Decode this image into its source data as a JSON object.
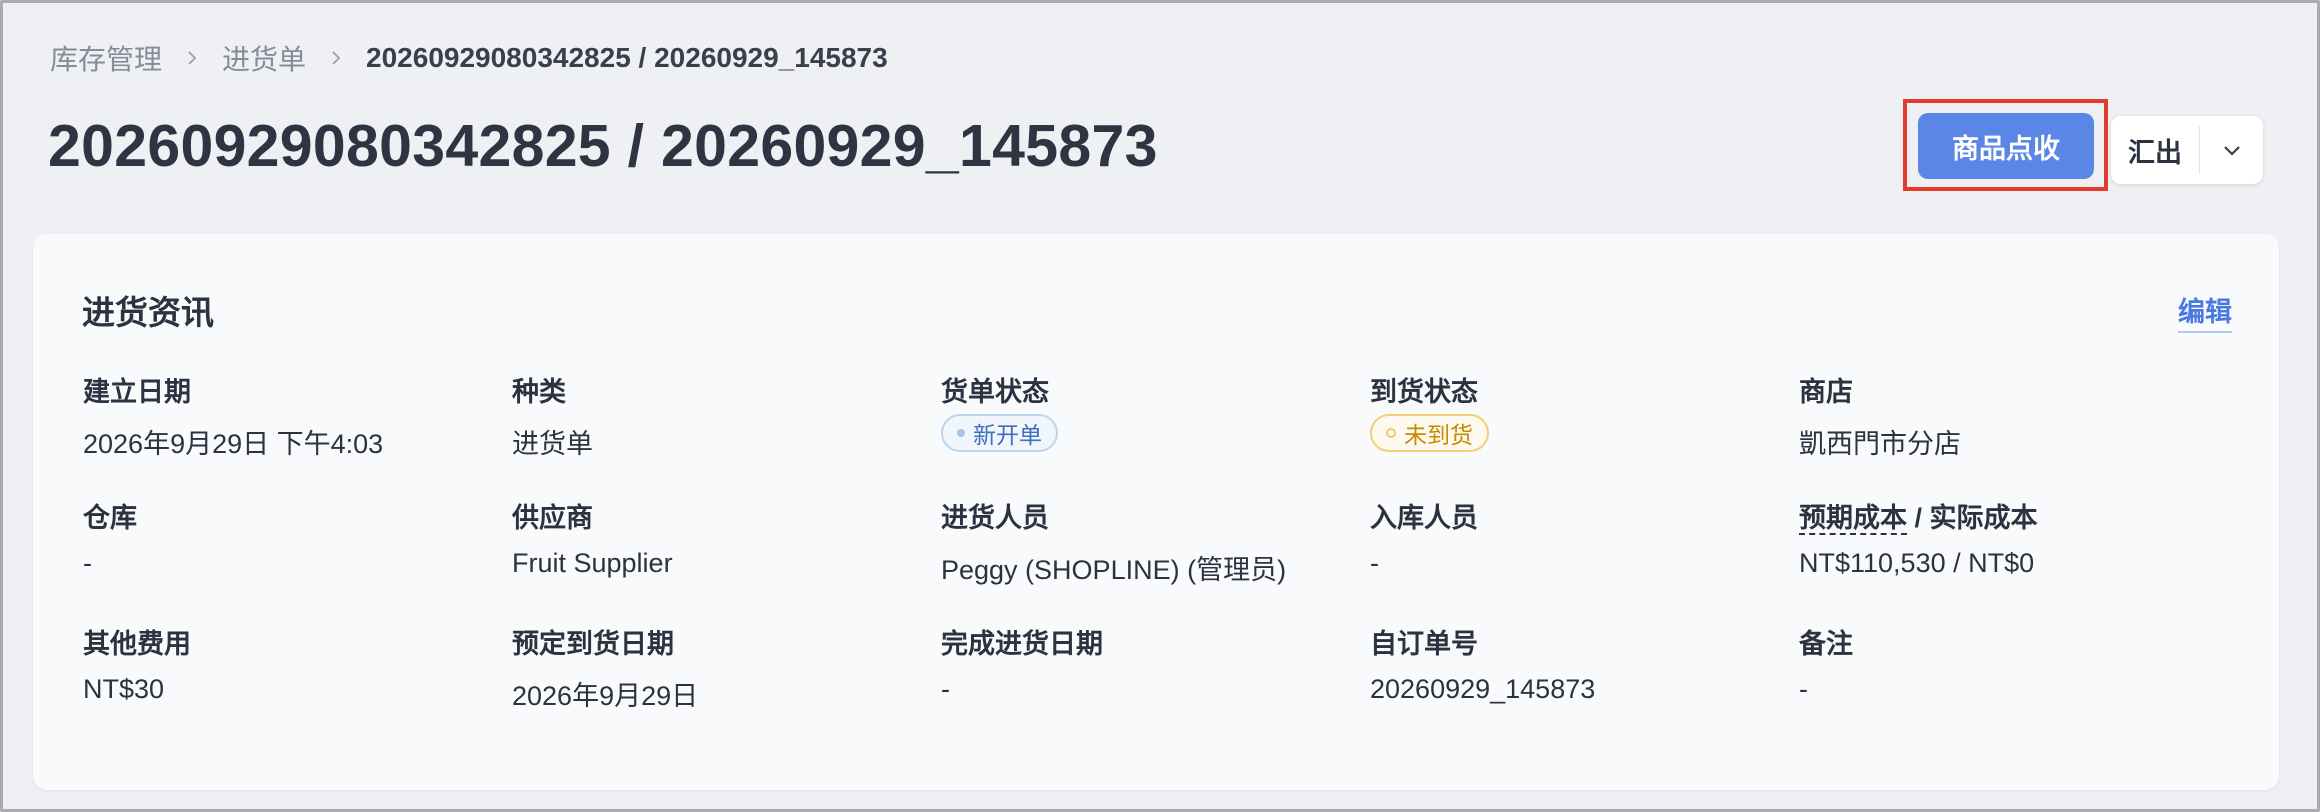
{
  "breadcrumb": {
    "items": [
      "库存管理",
      "进货单"
    ],
    "current": "20260929080342825 / 20260929_145873"
  },
  "page_title": "20260929080342825 / 20260929_145873",
  "actions": {
    "receive_label": "商品点收",
    "export_label": "汇出"
  },
  "colors": {
    "primary": "#5a87e6",
    "highlight": "#e03b2c",
    "link": "#4a79df"
  },
  "card": {
    "title": "进货资讯",
    "edit_label": "编辑",
    "fields": {
      "created_date": {
        "label": "建立日期",
        "value": "2026年9月29日 下午4:03"
      },
      "type": {
        "label": "种类",
        "value": "进货单"
      },
      "order_status": {
        "label": "货单状态",
        "value": "新开单"
      },
      "arrival_status": {
        "label": "到货状态",
        "value": "未到货"
      },
      "store": {
        "label": "商店",
        "value": "凱西門市分店"
      },
      "warehouse": {
        "label": "仓库",
        "value": "-"
      },
      "supplier": {
        "label": "供应商",
        "value": "Fruit Supplier"
      },
      "purchaser": {
        "label": "进货人员",
        "value": "Peggy (SHOPLINE) (管理员)"
      },
      "receiver": {
        "label": "入库人员",
        "value": "-"
      },
      "cost": {
        "label_expected": "预期成本",
        "label_sep": " / ",
        "label_actual": "实际成本",
        "value": "NT$110,530 / NT$0"
      },
      "other_fees": {
        "label": "其他费用",
        "value": "NT$30"
      },
      "expected_arrival": {
        "label": "预定到货日期",
        "value": "2026年9月29日"
      },
      "completed_date": {
        "label": "完成进货日期",
        "value": "-"
      },
      "custom_order_no": {
        "label": "自订单号",
        "value": "20260929_145873"
      },
      "notes": {
        "label": "备注",
        "value": "-"
      }
    }
  }
}
